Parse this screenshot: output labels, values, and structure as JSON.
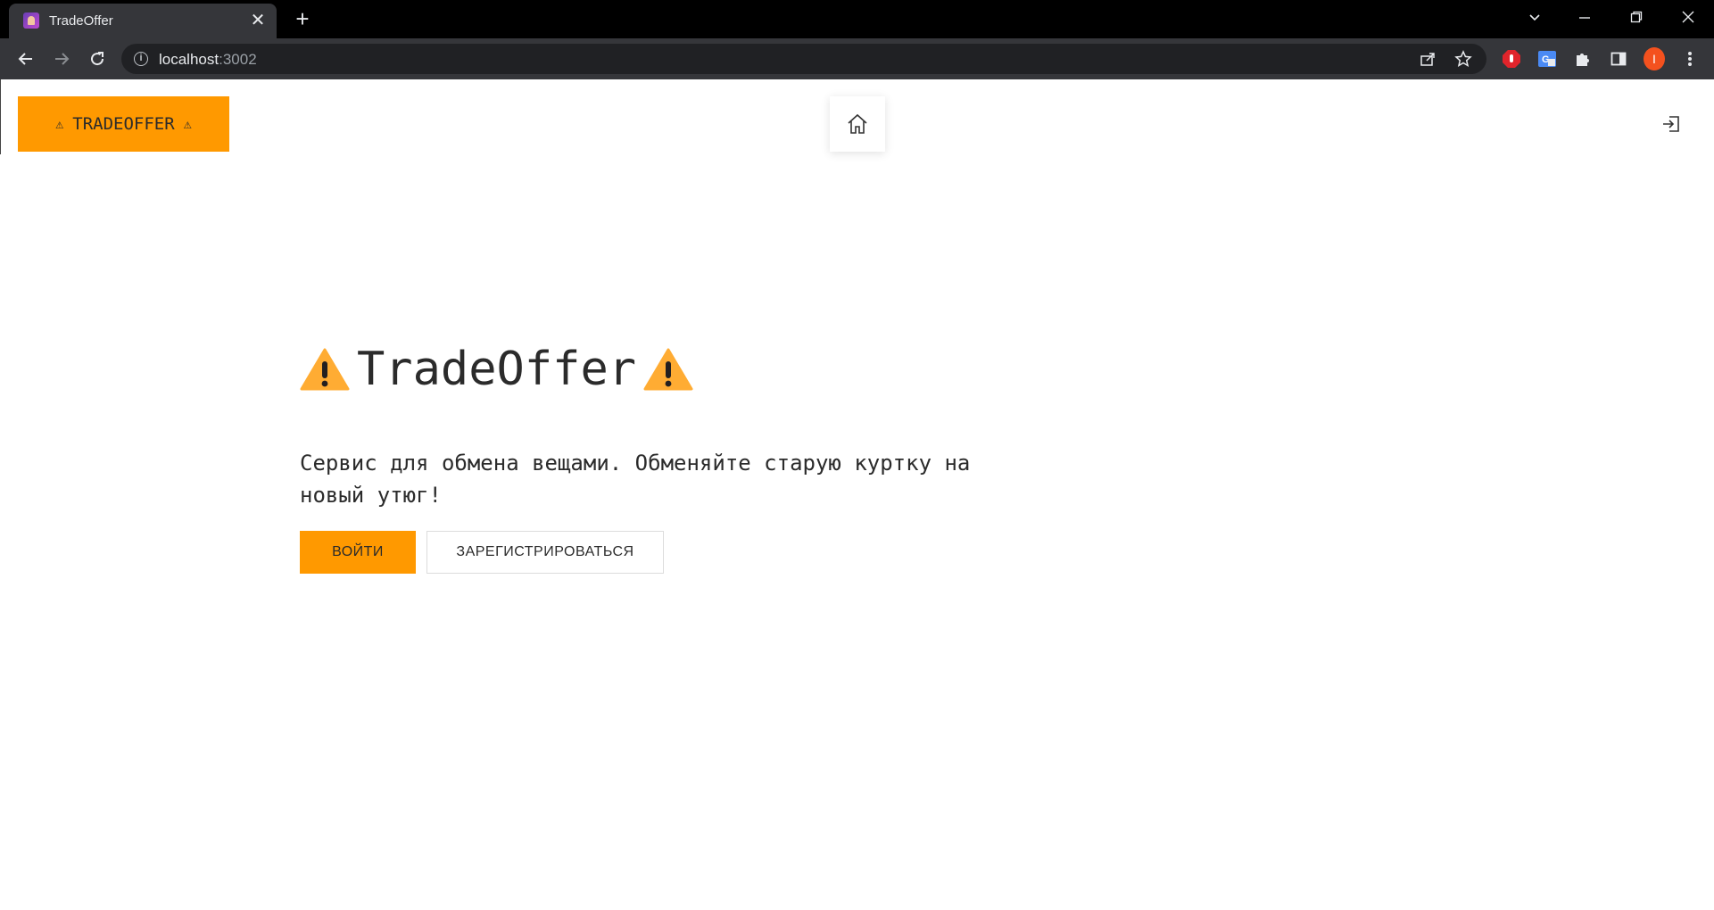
{
  "browser": {
    "tab": {
      "title": "TradeOffer",
      "close": "✕"
    },
    "new_tab": "+",
    "address": {
      "host": "localhost",
      "port": ":3002"
    },
    "profile_initial": "I"
  },
  "header": {
    "brand_label": "TRADEOFFER",
    "warn_glyph": "⚠"
  },
  "hero": {
    "title": "TradeOffer",
    "description": "Сервис для обмена вещами. Обменяйте старую куртку на новый утюг!",
    "login_button": "ВОЙТИ",
    "register_button": "ЗАРЕГИСТРИРОВАТЬСЯ"
  },
  "colors": {
    "accent": "#ff9900",
    "warning_icon": "#ffac33",
    "text": "#2b2b2b"
  }
}
